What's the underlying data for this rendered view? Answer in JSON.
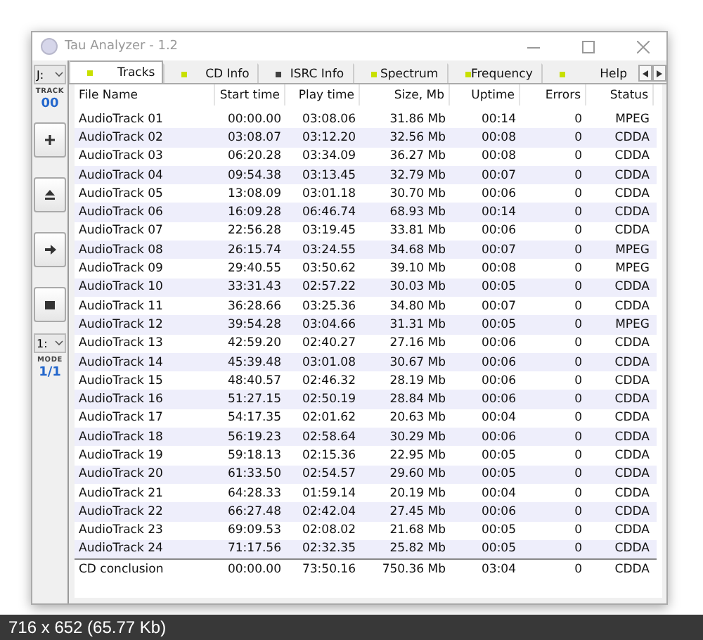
{
  "window": {
    "title": "Tau Analyzer - 1.2"
  },
  "toolbar": {
    "drive": "J:",
    "track_label": "TRACK",
    "track": "00",
    "mode_select": "1:",
    "mode_label": "MODE",
    "mode": "1/1"
  },
  "tabs": [
    {
      "label": "Tracks",
      "selected": true,
      "color": "#c8e000"
    },
    {
      "label": "CD Info",
      "selected": false,
      "color": "#c8e000"
    },
    {
      "label": "ISRC Info",
      "selected": false,
      "color": "#404040"
    },
    {
      "label": "Spectrum",
      "selected": false,
      "color": "#c8e000"
    },
    {
      "label": "Frequency",
      "selected": false,
      "color": "#c8e000"
    },
    {
      "label": "Help",
      "selected": false,
      "color": "#c8e000"
    }
  ],
  "table": {
    "columns": [
      "File Name",
      "Start time",
      "Play time",
      "Size, Mb",
      "Uptime",
      "Errors",
      "Status"
    ],
    "rows": [
      [
        "AudioTrack 01",
        "00:00.00",
        "03:08.06",
        "31.86 Mb",
        "00:14",
        "0",
        "MPEG"
      ],
      [
        "AudioTrack 02",
        "03:08.07",
        "03:12.20",
        "32.56 Mb",
        "00:08",
        "0",
        "CDDA"
      ],
      [
        "AudioTrack 03",
        "06:20.28",
        "03:34.09",
        "36.27 Mb",
        "00:08",
        "0",
        "CDDA"
      ],
      [
        "AudioTrack 04",
        "09:54.38",
        "03:13.45",
        "32.79 Mb",
        "00:07",
        "0",
        "CDDA"
      ],
      [
        "AudioTrack 05",
        "13:08.09",
        "03:01.18",
        "30.70 Mb",
        "00:06",
        "0",
        "CDDA"
      ],
      [
        "AudioTrack 06",
        "16:09.28",
        "06:46.74",
        "68.93 Mb",
        "00:14",
        "0",
        "CDDA"
      ],
      [
        "AudioTrack 07",
        "22:56.28",
        "03:19.45",
        "33.81 Mb",
        "00:06",
        "0",
        "CDDA"
      ],
      [
        "AudioTrack 08",
        "26:15.74",
        "03:24.55",
        "34.68 Mb",
        "00:07",
        "0",
        "MPEG"
      ],
      [
        "AudioTrack 09",
        "29:40.55",
        "03:50.62",
        "39.10 Mb",
        "00:08",
        "0",
        "MPEG"
      ],
      [
        "AudioTrack 10",
        "33:31.43",
        "02:57.22",
        "30.03 Mb",
        "00:05",
        "0",
        "CDDA"
      ],
      [
        "AudioTrack 11",
        "36:28.66",
        "03:25.36",
        "34.80 Mb",
        "00:07",
        "0",
        "CDDA"
      ],
      [
        "AudioTrack 12",
        "39:54.28",
        "03:04.66",
        "31.31 Mb",
        "00:05",
        "0",
        "MPEG"
      ],
      [
        "AudioTrack 13",
        "42:59.20",
        "02:40.27",
        "27.16 Mb",
        "00:06",
        "0",
        "CDDA"
      ],
      [
        "AudioTrack 14",
        "45:39.48",
        "03:01.08",
        "30.67 Mb",
        "00:06",
        "0",
        "CDDA"
      ],
      [
        "AudioTrack 15",
        "48:40.57",
        "02:46.32",
        "28.19 Mb",
        "00:06",
        "0",
        "CDDA"
      ],
      [
        "AudioTrack 16",
        "51:27.15",
        "02:50.19",
        "28.84 Mb",
        "00:06",
        "0",
        "CDDA"
      ],
      [
        "AudioTrack 17",
        "54:17.35",
        "02:01.62",
        "20.63 Mb",
        "00:04",
        "0",
        "CDDA"
      ],
      [
        "AudioTrack 18",
        "56:19.23",
        "02:58.64",
        "30.29 Mb",
        "00:06",
        "0",
        "CDDA"
      ],
      [
        "AudioTrack 19",
        "59:18.13",
        "02:15.36",
        "22.95 Mb",
        "00:05",
        "0",
        "CDDA"
      ],
      [
        "AudioTrack 20",
        "61:33.50",
        "02:54.57",
        "29.60 Mb",
        "00:05",
        "0",
        "CDDA"
      ],
      [
        "AudioTrack 21",
        "64:28.33",
        "01:59.14",
        "20.19 Mb",
        "00:04",
        "0",
        "CDDA"
      ],
      [
        "AudioTrack 22",
        "66:27.48",
        "02:42.04",
        "27.45 Mb",
        "00:06",
        "0",
        "CDDA"
      ],
      [
        "AudioTrack 23",
        "69:09.53",
        "02:08.02",
        "21.68 Mb",
        "00:05",
        "0",
        "CDDA"
      ],
      [
        "AudioTrack 24",
        "71:17.56",
        "02:32.35",
        "25.82 Mb",
        "00:05",
        "0",
        "CDDA"
      ]
    ],
    "summary": [
      "CD conclusion",
      "00:00.00",
      "73:50.16",
      "750.36 Mb",
      "03:04",
      "0",
      "CDDA"
    ]
  },
  "caption": "716 x 652 (65.77 Kb)"
}
